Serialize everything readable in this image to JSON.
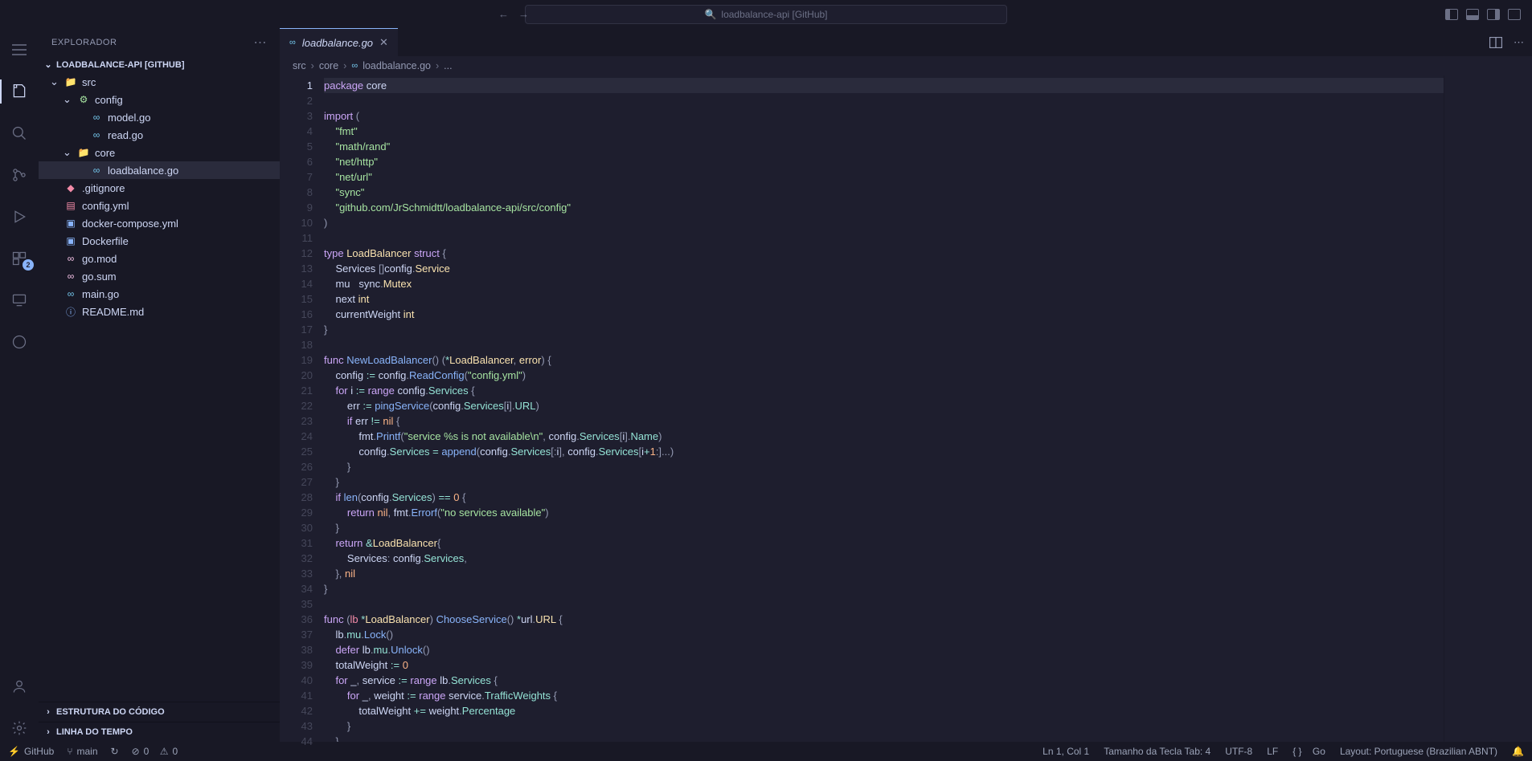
{
  "title_search": "loadbalance-api [GitHub]",
  "sidebar": {
    "header": "EXPLORADOR",
    "root": "LOADBALANCE-API [GITHUB]",
    "tree": [
      {
        "d": 0,
        "k": "folder",
        "open": true,
        "icon": "folder",
        "label": "src"
      },
      {
        "d": 1,
        "k": "folder",
        "open": true,
        "icon": "config",
        "label": "config"
      },
      {
        "d": 2,
        "k": "file",
        "icon": "go",
        "label": "model.go"
      },
      {
        "d": 2,
        "k": "file",
        "icon": "go",
        "label": "read.go"
      },
      {
        "d": 1,
        "k": "folder",
        "open": true,
        "icon": "folder",
        "label": "core"
      },
      {
        "d": 2,
        "k": "file",
        "icon": "go",
        "label": "loadbalance.go",
        "selected": true
      },
      {
        "d": 0,
        "k": "file",
        "icon": "git",
        "label": ".gitignore"
      },
      {
        "d": 0,
        "k": "file",
        "icon": "yml",
        "label": "config.yml"
      },
      {
        "d": 0,
        "k": "file",
        "icon": "docker",
        "label": "docker-compose.yml"
      },
      {
        "d": 0,
        "k": "file",
        "icon": "docker",
        "label": "Dockerfile"
      },
      {
        "d": 0,
        "k": "file",
        "icon": "mod",
        "label": "go.mod"
      },
      {
        "d": 0,
        "k": "file",
        "icon": "mod",
        "label": "go.sum"
      },
      {
        "d": 0,
        "k": "file",
        "icon": "go",
        "label": "main.go"
      },
      {
        "d": 0,
        "k": "file",
        "icon": "md",
        "label": "README.md"
      }
    ],
    "bottom": [
      "ESTRUTURA DO CÓDIGO",
      "LINHA DO TEMPO"
    ]
  },
  "tab": {
    "label": "loadbalance.go"
  },
  "breadcrumbs": [
    "src",
    "core",
    "loadbalance.go",
    "..."
  ],
  "code_lines": [
    "<span class='kw'>package</span> <span class='va'>core</span>",
    "",
    "<span class='kw'>import</span> <span class='pn'>(</span>",
    "    <span class='st'>\"fmt\"</span>",
    "    <span class='st'>\"math/rand\"</span>",
    "    <span class='st'>\"net/http\"</span>",
    "    <span class='st'>\"net/url\"</span>",
    "    <span class='st'>\"sync\"</span>",
    "    <span class='st'>\"github.com/JrSchmidtt/loadbalance-api/src/config\"</span>",
    "<span class='pn'>)</span>",
    "",
    "<span class='kw'>type</span> <span class='ty'>LoadBalancer</span> <span class='kw'>struct</span> <span class='pn'>{</span>",
    "    <span class='va'>Services</span> <span class='pn'>[]</span><span class='va'>config</span><span class='pn'>.</span><span class='ty'>Service</span>",
    "    <span class='va'>mu</span>   <span class='va'>sync</span><span class='pn'>.</span><span class='ty'>Mutex</span>",
    "    <span class='va'>next</span> <span class='ty'>int</span>",
    "    <span class='va'>currentWeight</span> <span class='ty'>int</span>",
    "<span class='pn'>}</span>",
    "",
    "<span class='kw'>func</span> <span class='fn'>NewLoadBalancer</span><span class='pn'>()</span> <span class='pn'>(</span><span class='op'>*</span><span class='ty'>LoadBalancer</span><span class='pn'>,</span> <span class='ty'>error</span><span class='pn'>)</span> <span class='pn'>{</span>",
    "    <span class='va'>config</span> <span class='op'>:=</span> <span class='va'>config</span><span class='pn'>.</span><span class='fn'>ReadConfig</span><span class='pn'>(</span><span class='st'>\"config.yml\"</span><span class='pn'>)</span>",
    "    <span class='kw'>for</span> <span class='va'>i</span> <span class='op'>:=</span> <span class='kw'>range</span> <span class='va'>config</span><span class='pn'>.</span><span class='pr'>Services</span> <span class='pn'>{</span>",
    "        <span class='va'>err</span> <span class='op'>:=</span> <span class='fn'>pingService</span><span class='pn'>(</span><span class='va'>config</span><span class='pn'>.</span><span class='pr'>Services</span><span class='pn'>[</span><span class='va'>i</span><span class='pn'>].</span><span class='pr'>URL</span><span class='pn'>)</span>",
    "        <span class='kw'>if</span> <span class='va'>err</span> <span class='op'>!=</span> <span class='nm'>nil</span> <span class='pn'>{</span>",
    "            <span class='va'>fmt</span><span class='pn'>.</span><span class='fn'>Printf</span><span class='pn'>(</span><span class='st'>\"service %s is not available\\n\"</span><span class='pn'>,</span> <span class='va'>config</span><span class='pn'>.</span><span class='pr'>Services</span><span class='pn'>[</span><span class='va'>i</span><span class='pn'>].</span><span class='pr'>Name</span><span class='pn'>)</span>",
    "            <span class='va'>config</span><span class='pn'>.</span><span class='pr'>Services</span> <span class='op'>=</span> <span class='fn'>append</span><span class='pn'>(</span><span class='va'>config</span><span class='pn'>.</span><span class='pr'>Services</span><span class='pn'>[:</span><span class='va'>i</span><span class='pn'>],</span> <span class='va'>config</span><span class='pn'>.</span><span class='pr'>Services</span><span class='pn'>[</span><span class='va'>i</span><span class='op'>+</span><span class='nm'>1</span><span class='pn'>:]...)</span>",
    "        <span class='pn'>}</span>",
    "    <span class='pn'>}</span>",
    "    <span class='kw'>if</span> <span class='fn'>len</span><span class='pn'>(</span><span class='va'>config</span><span class='pn'>.</span><span class='pr'>Services</span><span class='pn'>)</span> <span class='op'>==</span> <span class='nm'>0</span> <span class='pn'>{</span>",
    "        <span class='kw'>return</span> <span class='nm'>nil</span><span class='pn'>,</span> <span class='va'>fmt</span><span class='pn'>.</span><span class='fn'>Errorf</span><span class='pn'>(</span><span class='st'>\"no services available\"</span><span class='pn'>)</span>",
    "    <span class='pn'>}</span>",
    "    <span class='kw'>return</span> <span class='op'>&amp;</span><span class='ty'>LoadBalancer</span><span class='pn'>{</span>",
    "        <span class='va'>Services</span><span class='pn'>:</span> <span class='va'>config</span><span class='pn'>.</span><span class='pr'>Services</span><span class='pn'>,</span>",
    "    <span class='pn'>},</span> <span class='nm'>nil</span>",
    "<span class='pn'>}</span>",
    "",
    "<span class='kw'>func</span> <span class='pn'>(</span><span class='pa'>lb</span> <span class='op'>*</span><span class='ty'>LoadBalancer</span><span class='pn'>)</span> <span class='fn'>ChooseService</span><span class='pn'>()</span> <span class='op'>*</span><span class='va'>url</span><span class='pn'>.</span><span class='ty'>URL</span> <span class='pn'>{</span>",
    "    <span class='va'>lb</span><span class='pn'>.</span><span class='pr'>mu</span><span class='pn'>.</span><span class='fn'>Lock</span><span class='pn'>()</span>",
    "    <span class='kw'>defer</span> <span class='va'>lb</span><span class='pn'>.</span><span class='pr'>mu</span><span class='pn'>.</span><span class='fn'>Unlock</span><span class='pn'>()</span>",
    "    <span class='va'>totalWeight</span> <span class='op'>:=</span> <span class='nm'>0</span>",
    "    <span class='kw'>for</span> <span class='va'>_</span><span class='pn'>,</span> <span class='va'>service</span> <span class='op'>:=</span> <span class='kw'>range</span> <span class='va'>lb</span><span class='pn'>.</span><span class='pr'>Services</span> <span class='pn'>{</span>",
    "        <span class='kw'>for</span> <span class='va'>_</span><span class='pn'>,</span> <span class='va'>weight</span> <span class='op'>:=</span> <span class='kw'>range</span> <span class='va'>service</span><span class='pn'>.</span><span class='pr'>TrafficWeights</span> <span class='pn'>{</span>",
    "            <span class='va'>totalWeight</span> <span class='op'>+=</span> <span class='va'>weight</span><span class='pn'>.</span><span class='pr'>Percentage</span>",
    "        <span class='pn'>}</span>",
    "    <span class='pn'>}</span>"
  ],
  "statusbar": {
    "remote": "GitHub",
    "branch": "main",
    "sync": "↻",
    "errors": "0",
    "warnings": "0",
    "pos": "Ln 1, Col 1",
    "tab": "Tamanho da Tecla Tab: 4",
    "enc": "UTF-8",
    "eol": "LF",
    "lang": "Go",
    "layout": "Layout: Portuguese (Brazilian ABNT)"
  },
  "ext_badge": "2"
}
